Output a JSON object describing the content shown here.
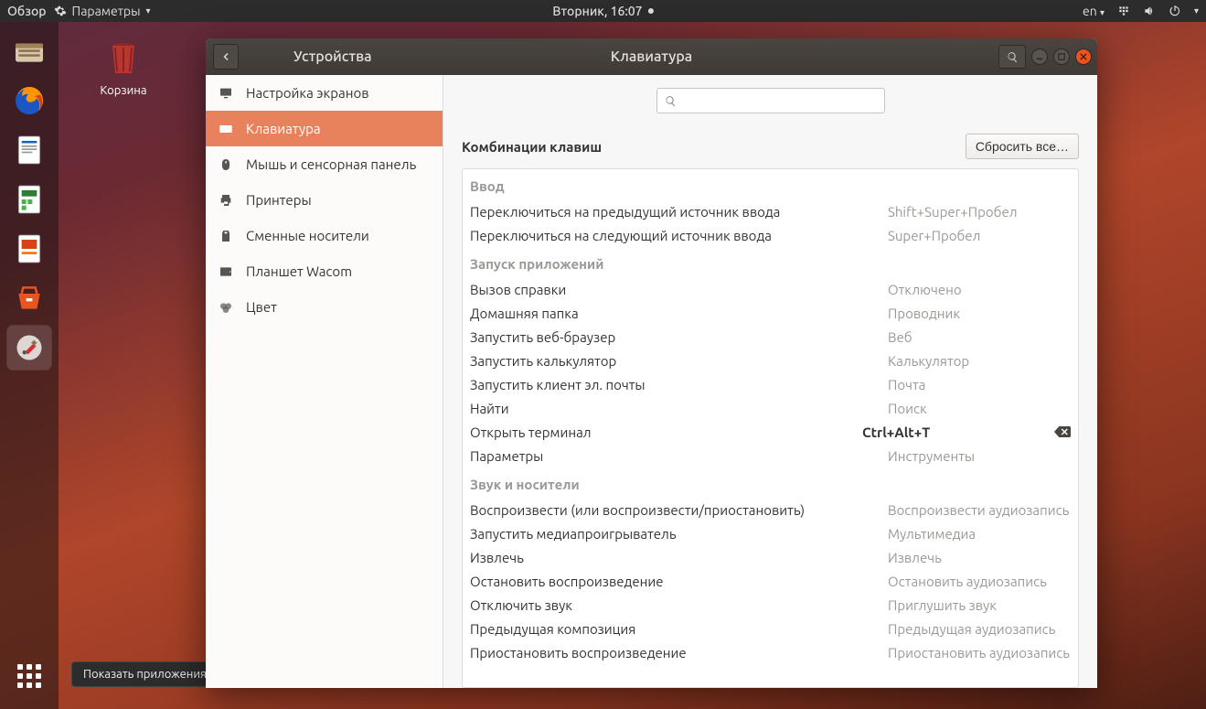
{
  "topbar": {
    "activities": "Обзор",
    "app_menu": "Параметры",
    "clock": "Вторник, 16:07",
    "lang": "en"
  },
  "desktop": {
    "trash_label": "Корзина"
  },
  "tooltip": "Показать приложения",
  "window": {
    "back_section": "Устройства",
    "title": "Клавиатура",
    "sidebar": [
      {
        "icon": "displays",
        "label": "Настройка экранов"
      },
      {
        "icon": "keyboard",
        "label": "Клавиатура",
        "active": true
      },
      {
        "icon": "mouse",
        "label": "Мышь и сенсорная панель"
      },
      {
        "icon": "printer",
        "label": "Принтеры"
      },
      {
        "icon": "removable",
        "label": "Сменные носители"
      },
      {
        "icon": "tablet",
        "label": "Планшет Wacom"
      },
      {
        "icon": "color",
        "label": "Цвет"
      }
    ],
    "search_placeholder": "",
    "heading": "Комбинации клавиш",
    "reset": "Сбросить все…",
    "sections": [
      {
        "title": "Ввод",
        "rows": [
          {
            "desc": "Переключиться на предыдущий источник ввода",
            "val": "Shift+Super+Пробел"
          },
          {
            "desc": "Переключиться на следующий источник ввода",
            "val": "Super+Пробел"
          }
        ]
      },
      {
        "title": "Запуск приложений",
        "rows": [
          {
            "desc": "Вызов справки",
            "val": "Отключено"
          },
          {
            "desc": "Домашняя папка",
            "val": "Проводник"
          },
          {
            "desc": "Запустить веб-браузер",
            "val": "Веб"
          },
          {
            "desc": "Запустить калькулятор",
            "val": "Калькулятор"
          },
          {
            "desc": "Запустить клиент эл. почты",
            "val": "Почта"
          },
          {
            "desc": "Найти",
            "val": "Поиск"
          },
          {
            "desc": "Открыть терминал",
            "val": "Ctrl+Alt+T",
            "bold": true,
            "erase": true
          },
          {
            "desc": "Параметры",
            "val": "Инструменты"
          }
        ]
      },
      {
        "title": "Звук и носители",
        "rows": [
          {
            "desc": "Воспроизвести (или воспроизвести/приостановить)",
            "val": "Воспроизвести аудиозапись"
          },
          {
            "desc": "Запустить медиапроигрыватель",
            "val": "Мультимедиа"
          },
          {
            "desc": "Извлечь",
            "val": "Извлечь"
          },
          {
            "desc": "Остановить воспроизведение",
            "val": "Остановить аудиозапись"
          },
          {
            "desc": "Отключить звук",
            "val": "Приглушить звук"
          },
          {
            "desc": "Предыдущая композиция",
            "val": "Предыдущая аудиозапись"
          },
          {
            "desc": "Приостановить воспроизведение",
            "val": "Приостановить аудиозапись"
          }
        ]
      }
    ]
  }
}
